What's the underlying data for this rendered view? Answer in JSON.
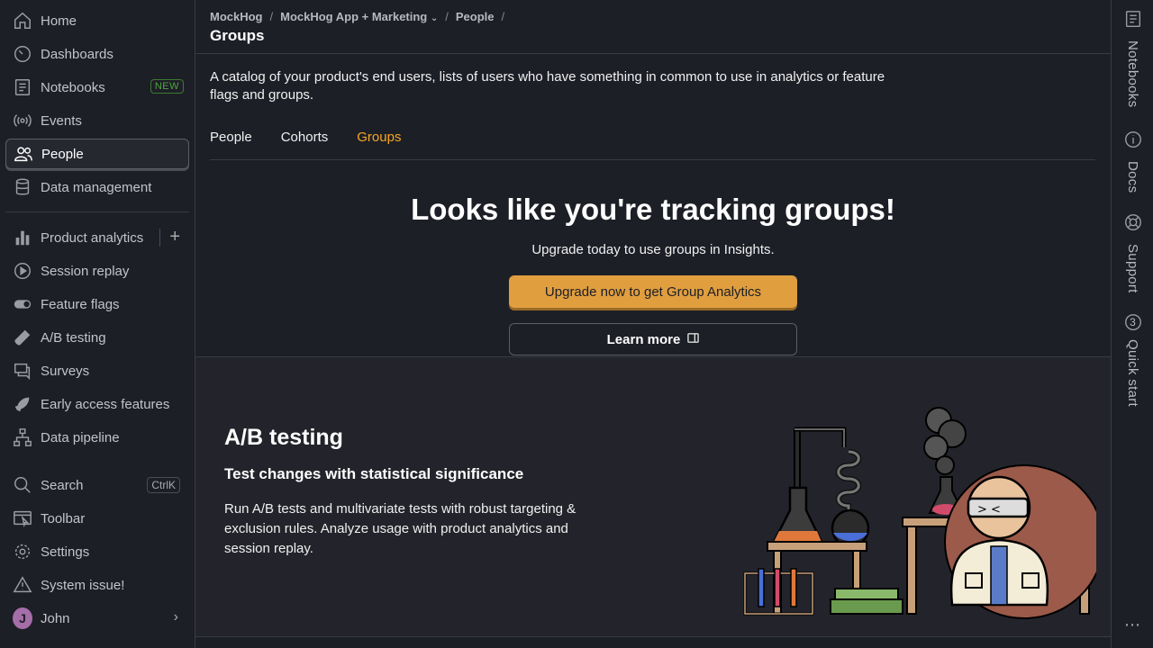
{
  "sidebar": {
    "items": [
      {
        "label": "Home"
      },
      {
        "label": "Dashboards"
      },
      {
        "label": "Notebooks",
        "badge": "NEW"
      },
      {
        "label": "Events"
      },
      {
        "label": "People"
      },
      {
        "label": "Data management"
      },
      {
        "label": "Product analytics"
      },
      {
        "label": "Session replay"
      },
      {
        "label": "Feature flags"
      },
      {
        "label": "A/B testing"
      },
      {
        "label": "Surveys"
      },
      {
        "label": "Early access features"
      },
      {
        "label": "Data pipeline"
      },
      {
        "label": "Search",
        "shortcut": "CtrlK"
      },
      {
        "label": "Toolbar"
      },
      {
        "label": "Settings"
      },
      {
        "label": "System issue!"
      },
      {
        "label": "John",
        "initial": "J"
      }
    ]
  },
  "header": {
    "breadcrumbs": [
      "MockHog",
      "MockHog App + Marketing",
      "People"
    ],
    "separator": "/",
    "title": "Groups"
  },
  "main": {
    "description": "A catalog of your product's end users, lists of users who have something in common to use in analytics or feature flags and groups.",
    "tabs": [
      {
        "label": "People"
      },
      {
        "label": "Cohorts"
      },
      {
        "label": "Groups"
      }
    ],
    "promo": {
      "title": "Looks like you're tracking groups!",
      "subtitle": "Upgrade today to use groups in Insights.",
      "primary_button": "Upgrade now to get Group Analytics",
      "secondary_button": "Learn more"
    },
    "panel": {
      "title": "A/B testing",
      "subtitle": "Test changes with statistical significance",
      "description": "Run A/B tests and multivariate tests with robust targeting & exclusion rules. Analyze usage with product analytics and session replay."
    }
  },
  "rail": {
    "items": [
      {
        "label": "Notebooks"
      },
      {
        "label": "Docs"
      },
      {
        "label": "Support"
      },
      {
        "label": "Quick start",
        "count": "3"
      }
    ],
    "more": "⋯"
  },
  "colors": {
    "accent": "#f5a623",
    "primary_button": "#e09e3f",
    "new_badge": "#4fa641",
    "avatar": "#a56ea8"
  }
}
